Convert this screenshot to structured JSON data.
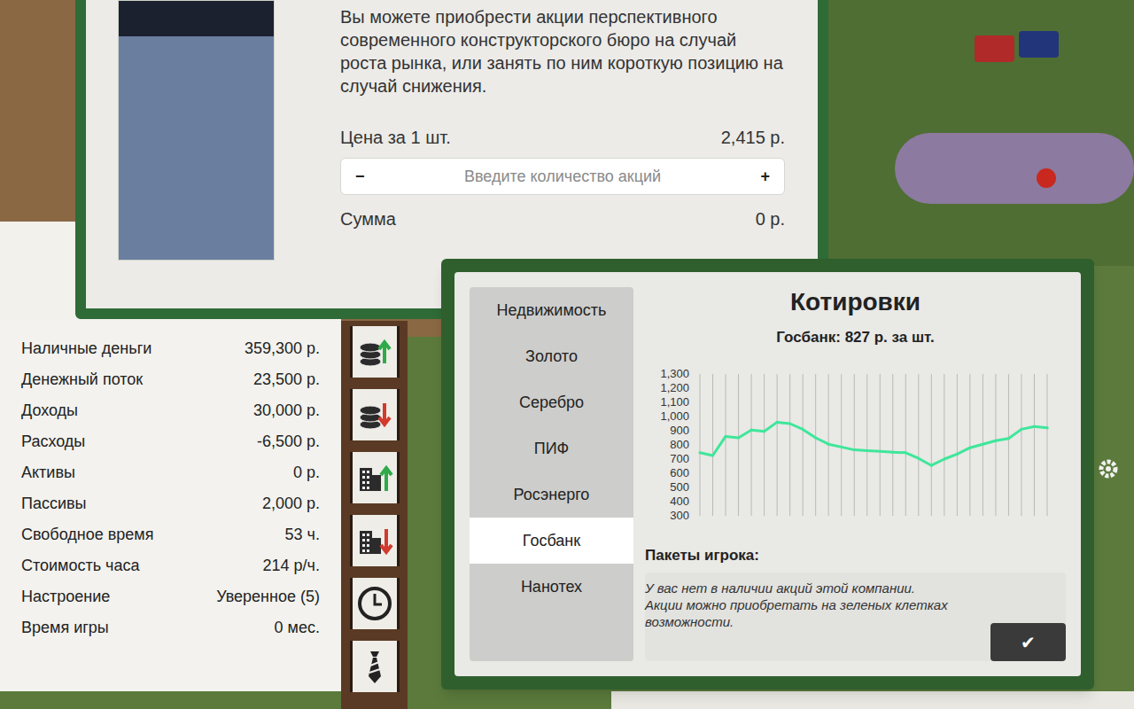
{
  "stock_offer": {
    "description": "Вы можете приобрести акции перспективного современного конструкторского бюро на случай роста рынка, или занять по ним короткую позицию на случай снижения.",
    "price_label": "Цена за 1 шт.",
    "price": "2,415 р.",
    "qty_minus": "−",
    "qty_placeholder": "Введите количество акций",
    "qty_plus": "+",
    "sum_label": "Сумма",
    "sum": "0 р."
  },
  "stats": [
    {
      "label": "Наличные деньги",
      "value": "359,300 р."
    },
    {
      "label": "Денежный поток",
      "value": "23,500 р."
    },
    {
      "label": "Доходы",
      "value": "30,000 р."
    },
    {
      "label": "Расходы",
      "value": "-6,500 р."
    },
    {
      "label": "Активы",
      "value": "0 р."
    },
    {
      "label": "Пассивы",
      "value": "2,000 р."
    },
    {
      "label": "Свободное время",
      "value": "53 ч."
    },
    {
      "label": "Стоимость часа",
      "value": "214 р/ч."
    },
    {
      "label": "Настроение",
      "value": "Уверенное (5)"
    },
    {
      "label": "Время игры",
      "value": "0 мес."
    }
  ],
  "toolbar": [
    {
      "kind": "buy-stock"
    },
    {
      "kind": "sell-stock"
    },
    {
      "kind": "buy-property"
    },
    {
      "kind": "sell-property"
    },
    {
      "kind": "time"
    },
    {
      "kind": "job"
    }
  ],
  "quotes": {
    "title": "Котировки",
    "subtitle": "Госбанк: 827 р. за шт.",
    "tabs": [
      {
        "label": "Недвижимость",
        "selected": false
      },
      {
        "label": "Золото",
        "selected": false
      },
      {
        "label": "Серебро",
        "selected": false
      },
      {
        "label": "ПИФ",
        "selected": false
      },
      {
        "label": "Росэнерго",
        "selected": false
      },
      {
        "label": "Госбанк",
        "selected": true
      },
      {
        "label": "Нанотех",
        "selected": false
      }
    ],
    "chart": {
      "y_ticks": [
        "1,300",
        "1,200",
        "1,100",
        "1,000",
        "900",
        "800",
        "700",
        "600",
        "500",
        "400",
        "300"
      ],
      "series": [
        {
          "values": [
            745,
            725,
            860,
            850,
            905,
            895,
            960,
            950,
            910,
            850,
            805,
            785,
            765,
            760,
            755,
            748,
            745,
            705,
            655,
            700,
            735,
            780,
            805,
            830,
            845,
            910,
            930,
            920
          ]
        }
      ]
    },
    "holdings_label": "Пакеты игрока:",
    "holdings_note": "У вас нет в наличии акций этой компании. Акции можно приобретать на зеленых клетках возможности.",
    "ok": "✔"
  }
}
